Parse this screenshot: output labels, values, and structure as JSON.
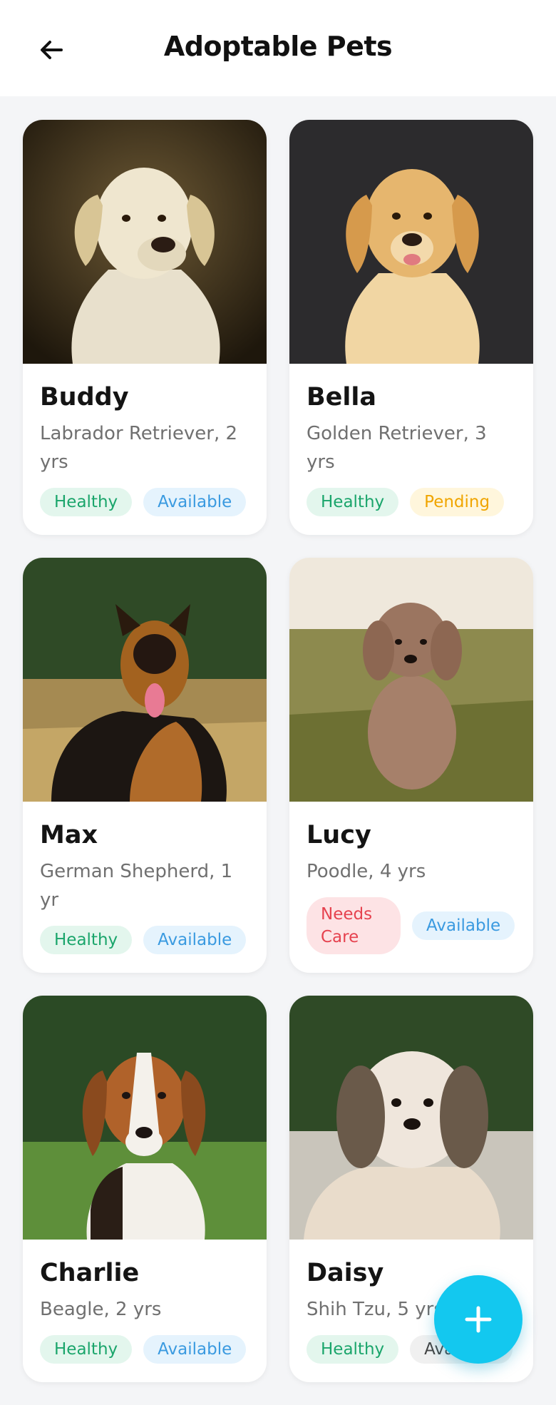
{
  "header": {
    "title": "Adoptable Pets",
    "back_icon": "arrow-left-icon"
  },
  "pets": [
    {
      "name": "Buddy",
      "desc": "Labrador Retriever, 2 yrs",
      "tags": [
        {
          "label": "Healthy",
          "kind": "healthy"
        },
        {
          "label": "Available",
          "kind": "available"
        }
      ]
    },
    {
      "name": "Bella",
      "desc": "Golden Retriever, 3 yrs",
      "tags": [
        {
          "label": "Healthy",
          "kind": "healthy"
        },
        {
          "label": "Pending",
          "kind": "pending"
        }
      ]
    },
    {
      "name": "Max",
      "desc": "German Shepherd, 1 yr",
      "tags": [
        {
          "label": "Healthy",
          "kind": "healthy"
        },
        {
          "label": "Available",
          "kind": "available"
        }
      ]
    },
    {
      "name": "Lucy",
      "desc": "Poodle, 4 yrs",
      "tags": [
        {
          "label": "Needs Care",
          "kind": "needs"
        },
        {
          "label": "Available",
          "kind": "available"
        }
      ]
    },
    {
      "name": "Charlie",
      "desc": "Beagle, 2 yrs",
      "tags": [
        {
          "label": "Healthy",
          "kind": "healthy"
        },
        {
          "label": "Available",
          "kind": "available"
        }
      ]
    },
    {
      "name": "Daisy",
      "desc": "Shih Tzu, 5 yrs",
      "tags": [
        {
          "label": "Healthy",
          "kind": "healthy"
        },
        {
          "label": "Available",
          "kind": "available"
        }
      ]
    }
  ],
  "fab": {
    "icon": "plus-icon",
    "color": "#13c8ef"
  }
}
